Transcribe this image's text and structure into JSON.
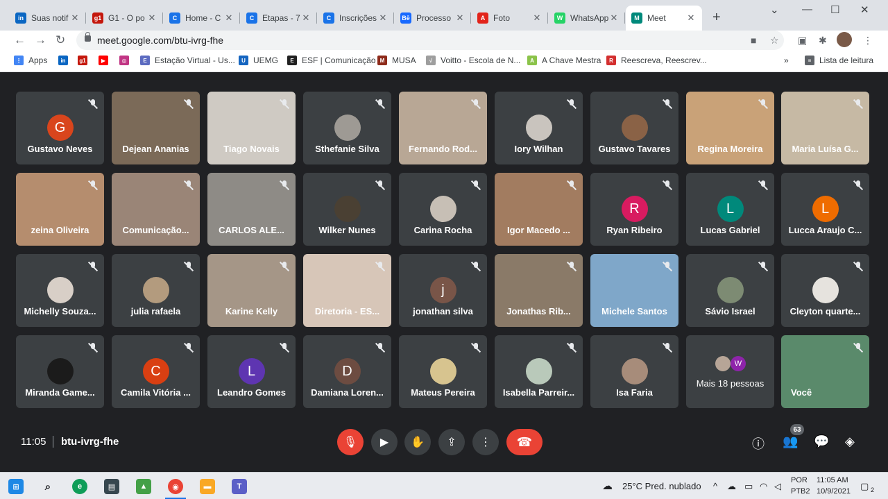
{
  "browser": {
    "tabs": [
      {
        "title": "Suas notif",
        "favicon_text": "in",
        "favicon_color": "#0a66c2"
      },
      {
        "title": "G1 - O po",
        "favicon_text": "g1",
        "favicon_color": "#c4170c"
      },
      {
        "title": "Home - C",
        "favicon_text": "C",
        "favicon_color": "#1a73e8"
      },
      {
        "title": "Etapas - 7",
        "favicon_text": "C",
        "favicon_color": "#1a73e8"
      },
      {
        "title": "Inscrições",
        "favicon_text": "C",
        "favicon_color": "#1a73e8"
      },
      {
        "title": "Processo",
        "favicon_text": "Bē",
        "favicon_color": "#1769ff"
      },
      {
        "title": "Foto",
        "favicon_text": "A",
        "favicon_color": "#e2231a"
      },
      {
        "title": "WhatsApp",
        "favicon_text": "W",
        "favicon_color": "#25d366"
      },
      {
        "title": "Meet",
        "favicon_text": "M",
        "favicon_color": "#00897b",
        "active": true
      }
    ],
    "url": "meet.google.com/btu-ivrg-fhe",
    "bookmarks": [
      {
        "label": "Apps",
        "icon_color": "#4285f4",
        "icon_text": "⋮"
      },
      {
        "label": "",
        "icon_color": "#0a66c2",
        "icon_text": "in"
      },
      {
        "label": "",
        "icon_color": "#c4170c",
        "icon_text": "g1"
      },
      {
        "label": "",
        "icon_color": "#ff0000",
        "icon_text": "▶"
      },
      {
        "label": "",
        "icon_color": "#c13584",
        "icon_text": "◎"
      },
      {
        "label": "Estação Virtual - Us...",
        "icon_color": "#5c6bc0",
        "icon_text": "E"
      },
      {
        "label": "UEMG",
        "icon_color": "#1565c0",
        "icon_text": "U"
      },
      {
        "label": "ESF | Comunicação",
        "icon_color": "#212121",
        "icon_text": "E"
      },
      {
        "label": "MUSA",
        "icon_color": "#8d2a1a",
        "icon_text": "M"
      },
      {
        "label": "Voitto - Escola de N...",
        "icon_color": "#9e9e9e",
        "icon_text": "√"
      },
      {
        "label": "A Chave Mestra",
        "icon_color": "#8bc34a",
        "icon_text": "A"
      },
      {
        "label": "Reescreva, Reescrev...",
        "icon_color": "#d32f2f",
        "icon_text": "R"
      }
    ],
    "reading_list": "Lista de leitura"
  },
  "meet": {
    "participants": [
      {
        "name": "Gustavo Neves",
        "initial": "G",
        "color": "#d9451c",
        "kind": "letter"
      },
      {
        "name": "Dejean Ananias",
        "kind": "video",
        "color": "#7b6a58"
      },
      {
        "name": "Tiago Novais",
        "kind": "video",
        "color": "#cfcac3"
      },
      {
        "name": "Sthefanie Silva",
        "kind": "photo",
        "color": "#9e9a94"
      },
      {
        "name": "Fernando Rod...",
        "kind": "video",
        "color": "#b8a795"
      },
      {
        "name": "Iory Wilhan",
        "kind": "photo",
        "color": "#c9c4be"
      },
      {
        "name": "Gustavo Tavares",
        "kind": "photo",
        "color": "#8a6246"
      },
      {
        "name": "Regina Moreira",
        "kind": "video",
        "color": "#c9a278"
      },
      {
        "name": "Maria Luísa G...",
        "kind": "video",
        "color": "#c6b9a4"
      },
      {
        "name": "zeina Oliveira",
        "kind": "video",
        "color": "#b58d6e"
      },
      {
        "name": "Comunicação...",
        "kind": "video",
        "color": "#9a8577"
      },
      {
        "name": "CARLOS ALE...",
        "kind": "video",
        "color": "#8e8b86"
      },
      {
        "name": "Wilker Nunes",
        "kind": "photo",
        "color": "#4a4033"
      },
      {
        "name": "Carina Rocha",
        "kind": "photo",
        "color": "#c7bfb5"
      },
      {
        "name": "Igor Macedo ...",
        "kind": "video",
        "color": "#a27c60"
      },
      {
        "name": "Ryan Ribeiro",
        "initial": "R",
        "color": "#d81b60",
        "kind": "letter"
      },
      {
        "name": "Lucas Gabriel",
        "initial": "L",
        "color": "#00897b",
        "kind": "letter"
      },
      {
        "name": "Lucca Araujo C...",
        "initial": "L",
        "color": "#ef6c00",
        "kind": "letter"
      },
      {
        "name": "Michelly Souza...",
        "kind": "photo",
        "color": "#d8cfc7"
      },
      {
        "name": "julia rafaela",
        "kind": "photo",
        "color": "#b39b7e"
      },
      {
        "name": "Karine Kelly",
        "kind": "video",
        "color": "#a59687"
      },
      {
        "name": "Diretoria - ES...",
        "kind": "video",
        "color": "#d7c6b8"
      },
      {
        "name": "jonathan silva",
        "initial": "j",
        "color": "#795548",
        "kind": "letter"
      },
      {
        "name": "Jonathas Rib...",
        "kind": "video",
        "color": "#8a7a68"
      },
      {
        "name": "Michele Santos",
        "kind": "video",
        "color": "#7fa7c9"
      },
      {
        "name": "Sávio Israel",
        "kind": "photo",
        "color": "#7d8b73"
      },
      {
        "name": "Cleyton quarte...",
        "kind": "photo",
        "color": "#e6e3de"
      },
      {
        "name": "Miranda Game...",
        "kind": "photo",
        "color": "#1b1b1b"
      },
      {
        "name": "Camila Vitória ...",
        "initial": "C",
        "color": "#d93f12",
        "kind": "letter"
      },
      {
        "name": "Leandro Gomes",
        "initial": "L",
        "color": "#5e35b1",
        "kind": "letter"
      },
      {
        "name": "Damiana Loren...",
        "initial": "D",
        "color": "#6d4c41",
        "kind": "letter"
      },
      {
        "name": "Mateus Pereira",
        "kind": "photo",
        "color": "#d7c48f"
      },
      {
        "name": "Isabella Parreir...",
        "kind": "photo",
        "color": "#b9c9ba"
      },
      {
        "name": "Isa Faria",
        "kind": "photo",
        "color": "#a78c7a"
      },
      {
        "name": "Mais 18 pessoas",
        "kind": "more",
        "color": "#3c4043"
      },
      {
        "name": "Você",
        "kind": "self",
        "color": "#5a8a6b"
      }
    ],
    "more_initial": "W",
    "more_initial_color": "#8e24aa",
    "time": "11:05",
    "meeting_code": "btu-ivrg-fhe",
    "people_count": "63"
  },
  "taskbar": {
    "weather": "25°C  Pred. nublado",
    "lang_top": "POR",
    "lang_bottom": "PTB2",
    "clock_time": "11:05 AM",
    "clock_date": "10/9/2021",
    "notif_count": "2"
  }
}
